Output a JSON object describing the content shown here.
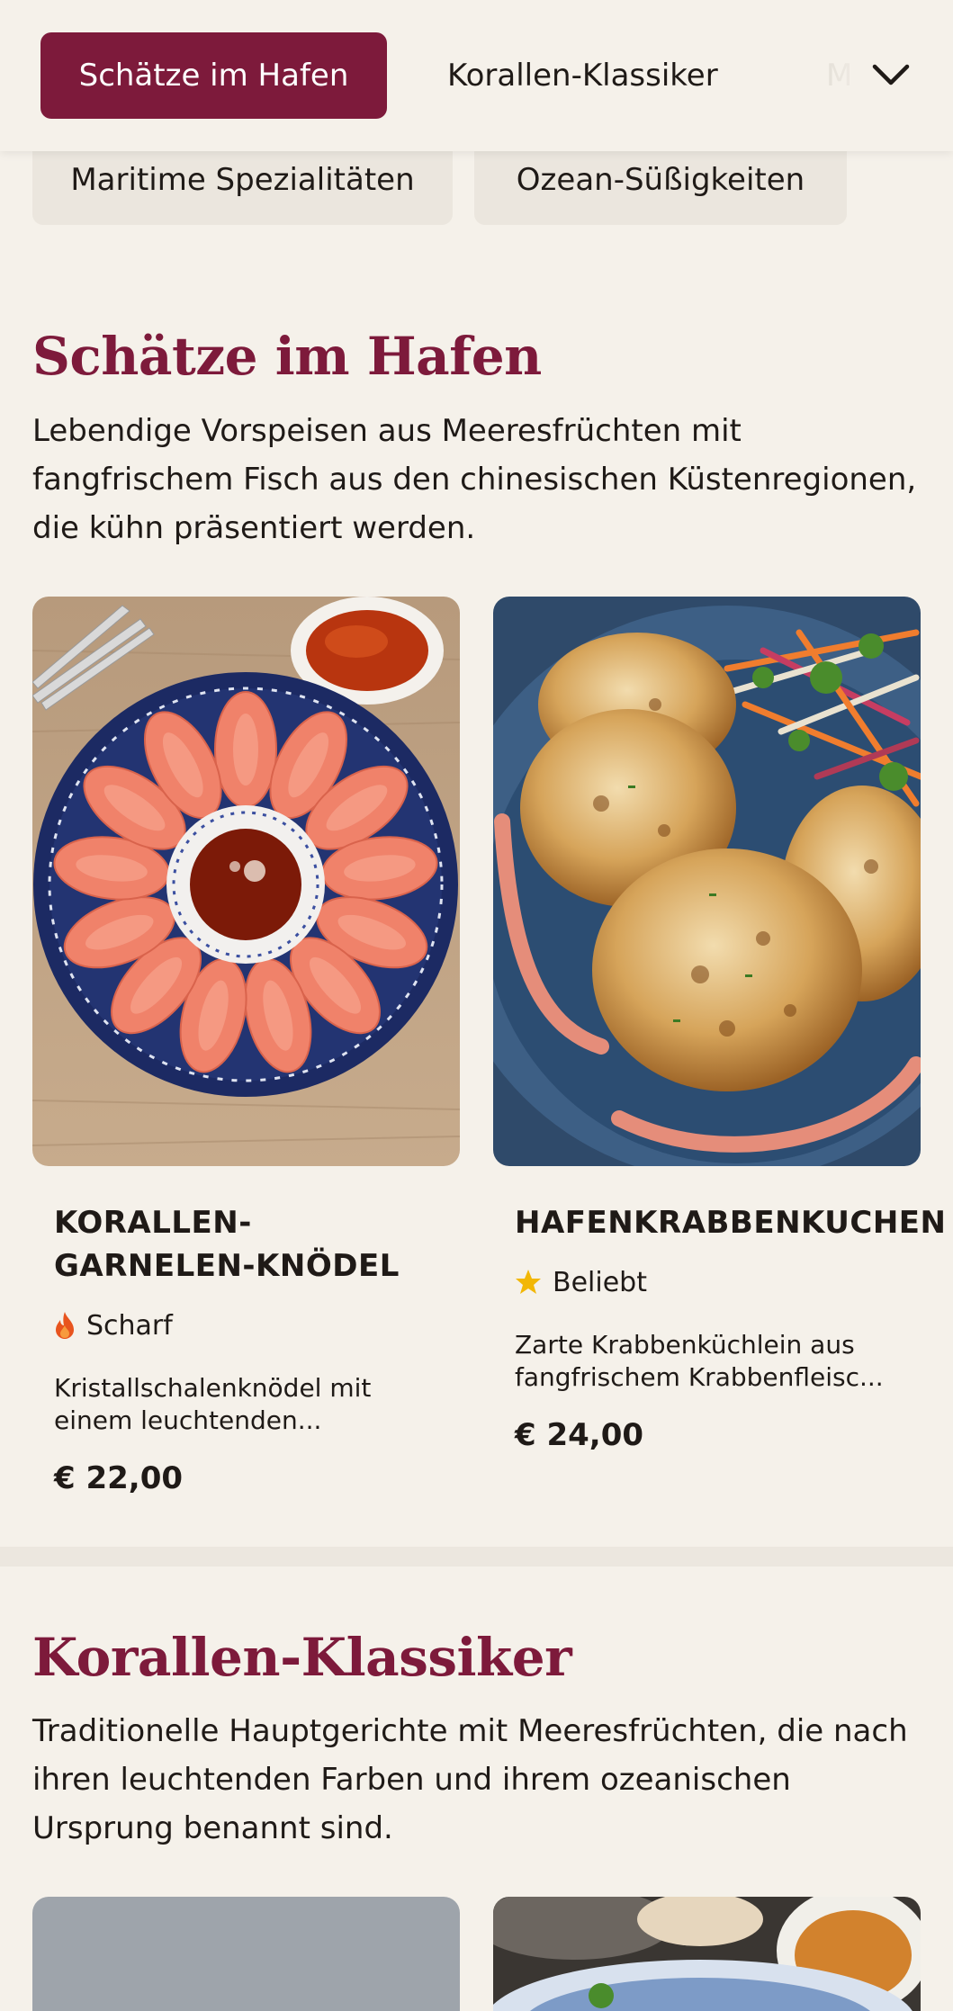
{
  "nav": {
    "tabs": [
      {
        "label": "Schätze im Hafen",
        "active": true
      },
      {
        "label": "Korallen-Klassiker",
        "active": false
      },
      {
        "label": "M",
        "active": false
      }
    ],
    "chips": [
      {
        "label": "Maritime Spezialitäten"
      },
      {
        "label": "Ozean-Süßigkeiten"
      }
    ],
    "expand_icon": "chevron-down-icon"
  },
  "sections": [
    {
      "title": "Schätze im Hafen",
      "description": "Lebendige Vorspeisen aus Meeresfrüchten mit fangfrischem Fisch aus den chinesischen Küstenregionen, die kühn präsentiert werden.",
      "dishes": [
        {
          "name": "KORALLEN-GARNELEN-KNÖDEL",
          "tag": "Scharf",
          "tag_icon": "flame-icon",
          "description": "Kristallschalenknödel mit einem leuchtenden...",
          "price": "€ 22,00"
        },
        {
          "name": "HAFENKRABBENKUCHEN",
          "tag": "Beliebt",
          "tag_icon": "star-icon",
          "description": "Zarte Krabbenküchlein aus fangfrischem Krabbenfleisc...",
          "price": "€ 24,00"
        }
      ]
    },
    {
      "title": "Korallen-Klassiker",
      "description": "Traditionelle Hauptgerichte mit Meeresfrüchten, die nach ihren leuchtenden Farben und ihrem ozeanischen Ursprung benannt sind."
    }
  ],
  "colors": {
    "accent": "#7d1a3b",
    "background": "#f5f1ea",
    "chip": "#ebe6de",
    "flame": "#e8541e",
    "star": "#f2b705"
  }
}
